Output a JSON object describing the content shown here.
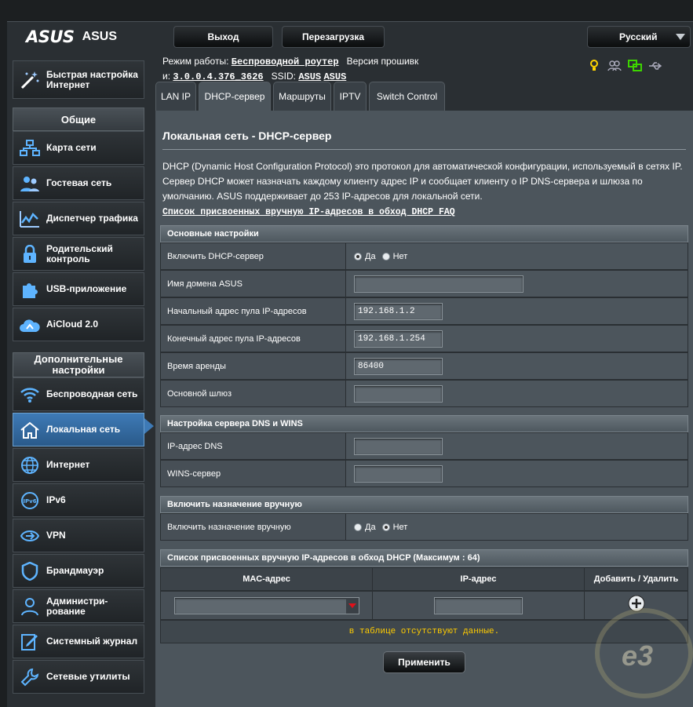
{
  "header": {
    "brand": "ASUS",
    "model": "ASUS",
    "logout": "Выход",
    "reboot": "Перезагрузка",
    "language": "Русский"
  },
  "info": {
    "mode_label": "Режим работы:",
    "mode_value": "Беспроводной роутер",
    "firmware_label": "Версия прошивк",
    "firmware_prefix": "и:",
    "firmware_value": "3.0.0.4.376_3626",
    "ssid_label": "SSID:",
    "ssid_1": "ASUS",
    "ssid_2": "ASUS"
  },
  "sidebar": {
    "quick_setup": "Быстрая настройка Интернет",
    "general_header": "Общие",
    "general": [
      "Карта сети",
      "Гостевая сеть",
      "Диспетчер трафика",
      "Родительский контроль",
      "USB-приложение",
      "AiCloud 2.0"
    ],
    "advanced_header": "Дополнительные настройки",
    "advanced": [
      "Беспроводная сеть",
      "Локальная сеть",
      "Интернет",
      "IPv6",
      "VPN",
      "Брандмауэр",
      "Администри-рование",
      "Системный журнал",
      "Сетевые утилиты"
    ]
  },
  "tabs": [
    "LAN IP",
    "DHCP-сервер",
    "Маршруты",
    "IPTV",
    "Switch Control"
  ],
  "page": {
    "title": "Локальная сеть - DHCP-сервер",
    "description": "DHCP (Dynamic Host Configuration Protocol) это протокол для автоматической конфигурации, используемый в сетях IP. Сервер DHCP может назначать каждому клиенту адрес IP и сообщает клиенту о IP DNS-сервера и шлюза по умолчанию. ASUS поддерживает до 253 IP-адресов для локальной сети.",
    "faq_link": "Список присвоенных вручную IP-адресов в обход DHCP FAQ"
  },
  "basic": {
    "header": "Основные настройки",
    "enable_label": "Включить DHCP-сервер",
    "yes": "Да",
    "no": "Нет",
    "domain_label": "Имя домена ASUS",
    "domain_value": "",
    "start_label": "Начальный адрес пула IP-адресов",
    "start_value": "192.168.1.2",
    "end_label": "Конечный адрес пула IP-адресов",
    "end_value": "192.168.1.254",
    "lease_label": "Время аренды",
    "lease_value": "86400",
    "gateway_label": "Основной шлюз",
    "gateway_value": ""
  },
  "dns": {
    "header": "Настройка сервера DNS и WINS",
    "dns_label": "IP-адрес DNS",
    "dns_value": "",
    "wins_label": "WINS-сервер",
    "wins_value": ""
  },
  "manual": {
    "header": "Включить назначение вручную",
    "label": "Включить назначение вручную",
    "yes": "Да",
    "no": "Нет"
  },
  "list": {
    "header": "Список присвоенных вручную IP-адресов в обход DHCP (Максимум : 64)",
    "col_mac": "MAC-адрес",
    "col_ip": "IP-адрес",
    "col_action": "Добавить / Удалить",
    "empty": "в таблице отсутствуют данные."
  },
  "apply": "Применить",
  "colors": {
    "accent": "#3e7ab6",
    "warning": "#ffcc00",
    "status_green": "#3dd400",
    "status_yellow": "#ffd400"
  }
}
